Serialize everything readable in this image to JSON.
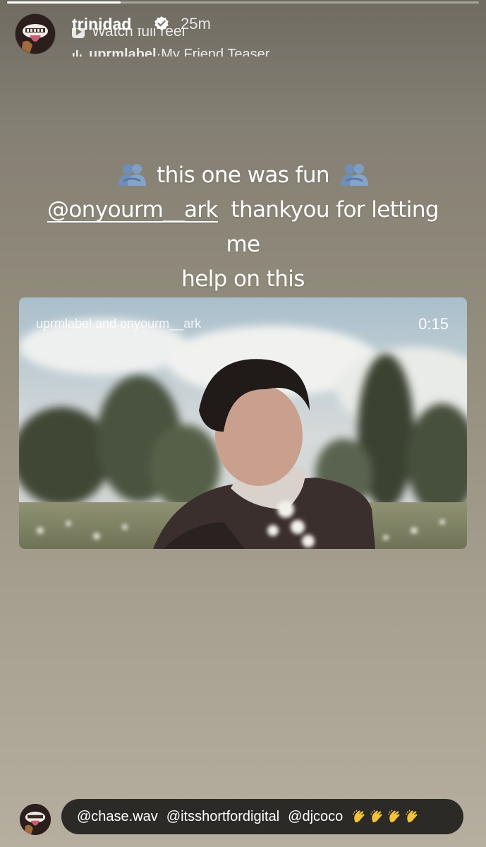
{
  "story": {
    "progress_fraction": 0.24
  },
  "header": {
    "username": "trinidad",
    "timestamp": "25m",
    "music_line_1": "Watch full reel",
    "music_account": "uprmlabel",
    "music_separator": " · ",
    "music_track": "My Friend Teaser"
  },
  "caption": {
    "line1_text": "this one was fun",
    "mention": "@onyourm__ark",
    "line2_text": "thankyou for letting me",
    "line3_text": "help on this"
  },
  "video": {
    "credit": "uprmlabel and onyourm__ark",
    "duration": "0:15"
  },
  "mentions_bar": {
    "handles": [
      "@chase.wav",
      "@itsshortfordigital",
      "@djcoco"
    ],
    "emoji": "clapping-hands x4"
  },
  "colors": {
    "background_top": "#6f6b61",
    "background_bottom": "#b6ae9f",
    "pill": "#2b2a27",
    "emoji_blue": "#6f8fb8"
  },
  "icons": [
    "verified-icon",
    "play-icon",
    "music-bars-icon",
    "hugging-people-emoji",
    "clapping-hands-emoji"
  ]
}
